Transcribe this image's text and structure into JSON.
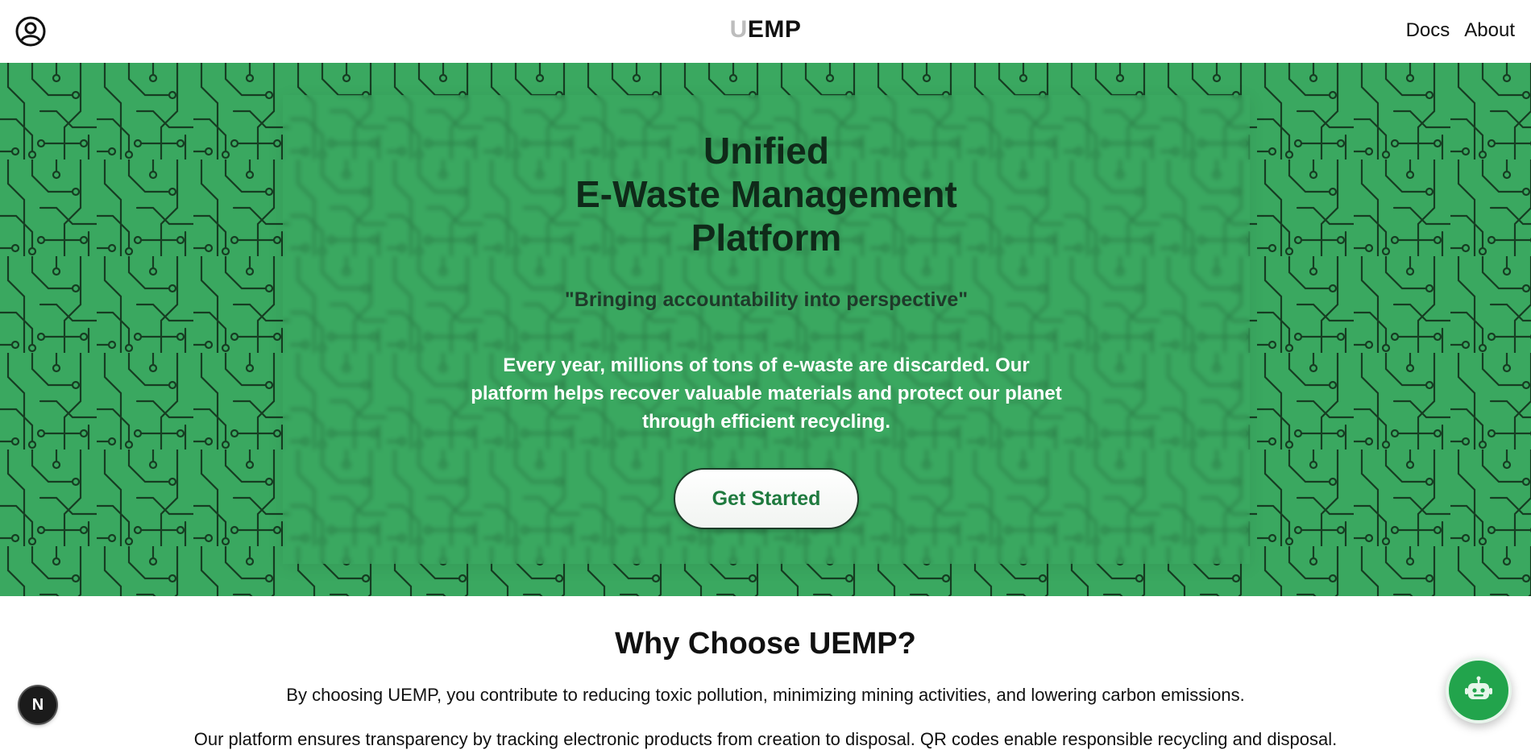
{
  "header": {
    "logo_first": "U",
    "logo_rest": "EMP",
    "nav": [
      {
        "label": "Docs"
      },
      {
        "label": "About"
      }
    ],
    "user_icon": "user-circle-icon"
  },
  "hero": {
    "title_lines": [
      "Unified",
      "E-Waste Management",
      "Platform"
    ],
    "tagline": "\"Bringing accountability into perspective\"",
    "description": "Every year, millions of tons of e-waste are discarded. Our platform helps recover valuable materials and protect our planet through efficient recycling.",
    "cta_label": "Get Started",
    "background_color": "#3aa860",
    "pattern": "circuit-board"
  },
  "why": {
    "title": "Why Choose UEMP?",
    "paragraph1": "By choosing UEMP, you contribute to reducing toxic pollution, minimizing mining activities, and lowering carbon emissions.",
    "paragraph2": "Our platform ensures transparency by tracking electronic products from creation to disposal. QR codes enable responsible recycling and disposal."
  },
  "floating": {
    "dev_badge_label": "N",
    "chatbot_icon": "robot-icon",
    "chatbot_color": "#22a44c"
  }
}
